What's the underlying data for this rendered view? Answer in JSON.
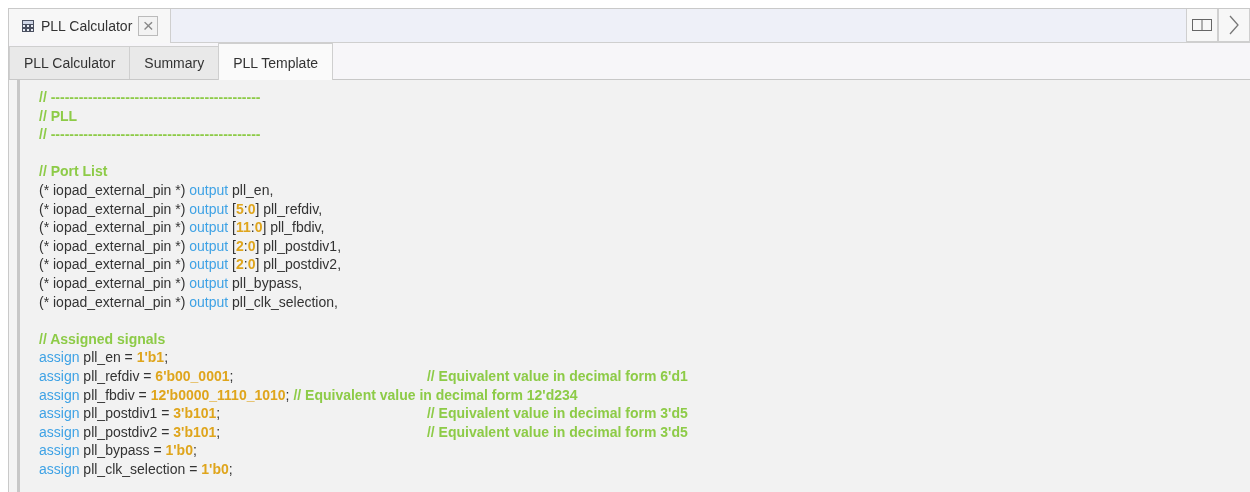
{
  "editor_tab": {
    "title": "PLL Calculator",
    "close": "×"
  },
  "tabs": [
    {
      "label": "PLL Calculator",
      "selected": false
    },
    {
      "label": "Summary",
      "selected": false
    },
    {
      "label": "PLL Template",
      "selected": true
    }
  ],
  "code_lines": [
    {
      "tokens": [
        {
          "kind": "comment",
          "text": "// ---------------------------------------------"
        }
      ]
    },
    {
      "tokens": [
        {
          "kind": "comment",
          "text": "// PLL"
        }
      ]
    },
    {
      "tokens": [
        {
          "kind": "comment",
          "text": "// ---------------------------------------------"
        }
      ]
    },
    {
      "kind": "blank"
    },
    {
      "tokens": [
        {
          "kind": "comment",
          "text": "// Port List"
        }
      ]
    },
    {
      "tokens": [
        {
          "kind": "plain",
          "text": "(* iopad_external_pin *) "
        },
        {
          "kind": "keyword",
          "text": "output"
        },
        {
          "kind": "plain",
          "text": " pll_en,"
        }
      ]
    },
    {
      "tokens": [
        {
          "kind": "plain",
          "text": "(* iopad_external_pin *) "
        },
        {
          "kind": "keyword",
          "text": "output"
        },
        {
          "kind": "plain",
          "text": " ["
        },
        {
          "kind": "number",
          "text": "5"
        },
        {
          "kind": "plain",
          "text": ":"
        },
        {
          "kind": "number",
          "text": "0"
        },
        {
          "kind": "plain",
          "text": "] pll_refdiv,"
        }
      ]
    },
    {
      "tokens": [
        {
          "kind": "plain",
          "text": "(* iopad_external_pin *) "
        },
        {
          "kind": "keyword",
          "text": "output"
        },
        {
          "kind": "plain",
          "text": " ["
        },
        {
          "kind": "number",
          "text": "11"
        },
        {
          "kind": "plain",
          "text": ":"
        },
        {
          "kind": "number",
          "text": "0"
        },
        {
          "kind": "plain",
          "text": "] pll_fbdiv,"
        }
      ]
    },
    {
      "tokens": [
        {
          "kind": "plain",
          "text": "(* iopad_external_pin *) "
        },
        {
          "kind": "keyword",
          "text": "output"
        },
        {
          "kind": "plain",
          "text": " ["
        },
        {
          "kind": "number",
          "text": "2"
        },
        {
          "kind": "plain",
          "text": ":"
        },
        {
          "kind": "number",
          "text": "0"
        },
        {
          "kind": "plain",
          "text": "] pll_postdiv1,"
        }
      ]
    },
    {
      "tokens": [
        {
          "kind": "plain",
          "text": "(* iopad_external_pin *) "
        },
        {
          "kind": "keyword",
          "text": "output"
        },
        {
          "kind": "plain",
          "text": " ["
        },
        {
          "kind": "number",
          "text": "2"
        },
        {
          "kind": "plain",
          "text": ":"
        },
        {
          "kind": "number",
          "text": "0"
        },
        {
          "kind": "plain",
          "text": "] pll_postdiv2,"
        }
      ]
    },
    {
      "tokens": [
        {
          "kind": "plain",
          "text": "(* iopad_external_pin *) "
        },
        {
          "kind": "keyword",
          "text": "output"
        },
        {
          "kind": "plain",
          "text": " pll_bypass,"
        }
      ]
    },
    {
      "tokens": [
        {
          "kind": "plain",
          "text": "(* iopad_external_pin *) "
        },
        {
          "kind": "keyword",
          "text": "output"
        },
        {
          "kind": "plain",
          "text": " pll_clk_selection,"
        }
      ]
    },
    {
      "kind": "blank"
    },
    {
      "tokens": [
        {
          "kind": "comment",
          "text": "// Assigned signals"
        }
      ]
    },
    {
      "tokens": [
        {
          "kind": "keyword",
          "text": "assign"
        },
        {
          "kind": "plain",
          "text": " pll_en = "
        },
        {
          "kind": "number",
          "text": "1'b1"
        },
        {
          "kind": "plain",
          "text": ";"
        }
      ]
    },
    {
      "tokens": [
        {
          "kind": "keyword",
          "text": "assign"
        },
        {
          "kind": "plain",
          "text": " pll_refdiv = "
        },
        {
          "kind": "number",
          "text": "6'b00_0001"
        },
        {
          "kind": "plain",
          "text": ";"
        }
      ],
      "trailing_comment": "// Equivalent value in decimal form 6'd1",
      "comment_aligned": true
    },
    {
      "tokens": [
        {
          "kind": "keyword",
          "text": "assign"
        },
        {
          "kind": "plain",
          "text": " pll_fbdiv = "
        },
        {
          "kind": "number",
          "text": "12'b0000_1110_1010"
        },
        {
          "kind": "plain",
          "text": ";"
        }
      ],
      "trailing_comment": "// Equivalent value in decimal form 12'd234",
      "comment_aligned": false
    },
    {
      "tokens": [
        {
          "kind": "keyword",
          "text": "assign"
        },
        {
          "kind": "plain",
          "text": " pll_postdiv1 = "
        },
        {
          "kind": "number",
          "text": "3'b101"
        },
        {
          "kind": "plain",
          "text": ";"
        }
      ],
      "trailing_comment": "// Equivalent value in decimal form 3'd5",
      "comment_aligned": true
    },
    {
      "tokens": [
        {
          "kind": "keyword",
          "text": "assign"
        },
        {
          "kind": "plain",
          "text": " pll_postdiv2 = "
        },
        {
          "kind": "number",
          "text": "3'b101"
        },
        {
          "kind": "plain",
          "text": ";"
        }
      ],
      "trailing_comment": "// Equivalent value in decimal form 3'd5",
      "comment_aligned": true
    },
    {
      "tokens": [
        {
          "kind": "keyword",
          "text": "assign"
        },
        {
          "kind": "plain",
          "text": " pll_bypass = "
        },
        {
          "kind": "number",
          "text": "1'b0"
        },
        {
          "kind": "plain",
          "text": ";"
        }
      ]
    },
    {
      "tokens": [
        {
          "kind": "keyword",
          "text": "assign"
        },
        {
          "kind": "plain",
          "text": " pll_clk_selection = "
        },
        {
          "kind": "number",
          "text": "1'b0"
        },
        {
          "kind": "plain",
          "text": ";"
        }
      ]
    }
  ]
}
